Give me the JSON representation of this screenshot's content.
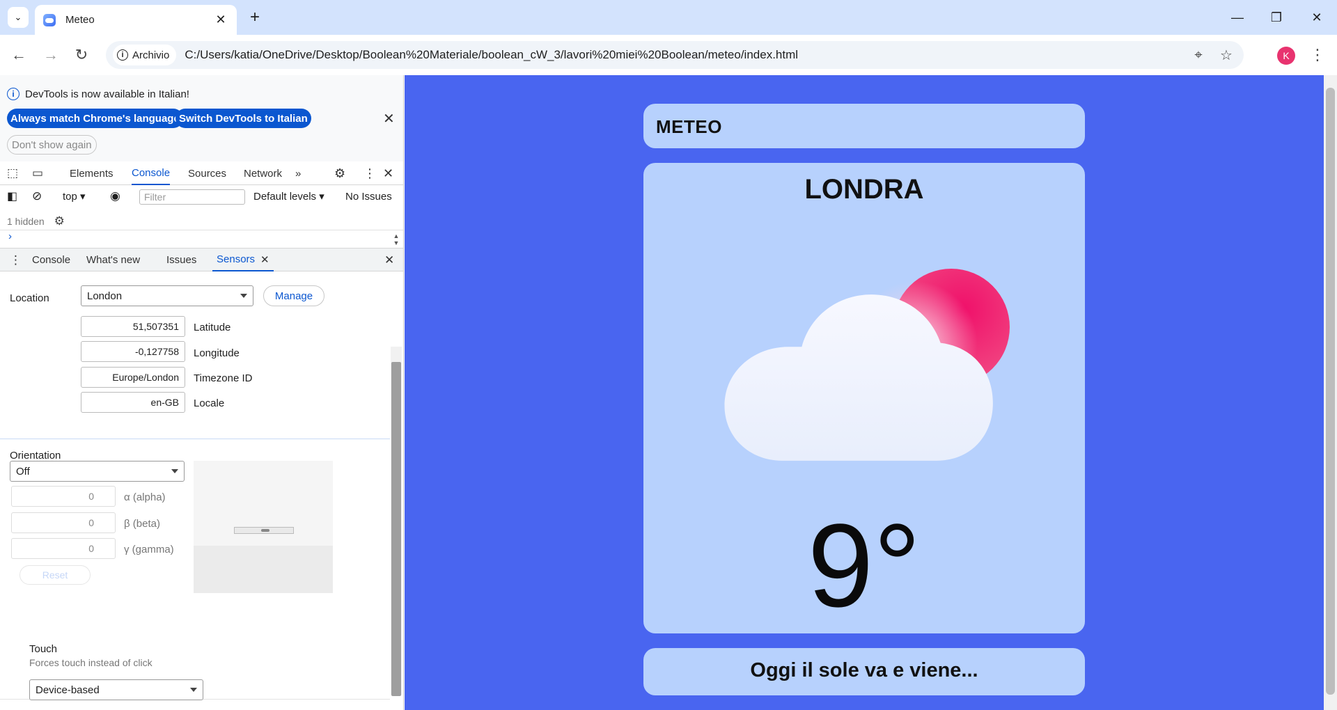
{
  "browser": {
    "tab_title": "Meteo",
    "site_chip": "Archivio",
    "url": "C:/Users/katia/OneDrive/Desktop/Boolean%20Materiale/boolean_cW_3/lavori%20miei%20Boolean/meteo/index.html",
    "profile_initial": "K"
  },
  "devtools": {
    "infobar": {
      "message": "DevTools is now available in Italian!",
      "match_button": "Always match Chrome's language",
      "switch_button": "Switch DevTools to Italian",
      "dismiss_button": "Don't show again"
    },
    "tabs": [
      "Elements",
      "Console",
      "Sources",
      "Network"
    ],
    "active_tab": "Console",
    "console": {
      "context": "top",
      "filter_placeholder": "Filter",
      "levels": "Default levels",
      "issues": "No Issues",
      "hidden": "1 hidden"
    },
    "drawer_tabs": [
      "Console",
      "What's new",
      "Issues",
      "Sensors"
    ],
    "active_drawer_tab": "Sensors",
    "sensors": {
      "location_label": "Location",
      "location_value": "London",
      "manage_button": "Manage",
      "latitude": "51,507351",
      "latitude_label": "Latitude",
      "longitude": "-0,127758",
      "longitude_label": "Longitude",
      "timezone": "Europe/London",
      "timezone_label": "Timezone ID",
      "locale": "en-GB",
      "locale_label": "Locale",
      "orientation_label": "Orientation",
      "orientation_value": "Off",
      "alpha": "0",
      "alpha_label": "α (alpha)",
      "beta": "0",
      "beta_label": "β (beta)",
      "gamma": "0",
      "gamma_label": "γ (gamma)",
      "reset_button": "Reset",
      "touch_label": "Touch",
      "touch_desc": "Forces touch instead of click",
      "touch_value": "Device-based"
    }
  },
  "app": {
    "header": "METEO",
    "city": "LONDRA",
    "temperature": "9°",
    "forecast_text": "Oggi il sole va e viene...",
    "weather_icon": "partly-cloudy-icon",
    "colors": {
      "page_bg": "#4965f0",
      "card_bg": "#b7d1fd",
      "sun": "#f0206e"
    }
  }
}
